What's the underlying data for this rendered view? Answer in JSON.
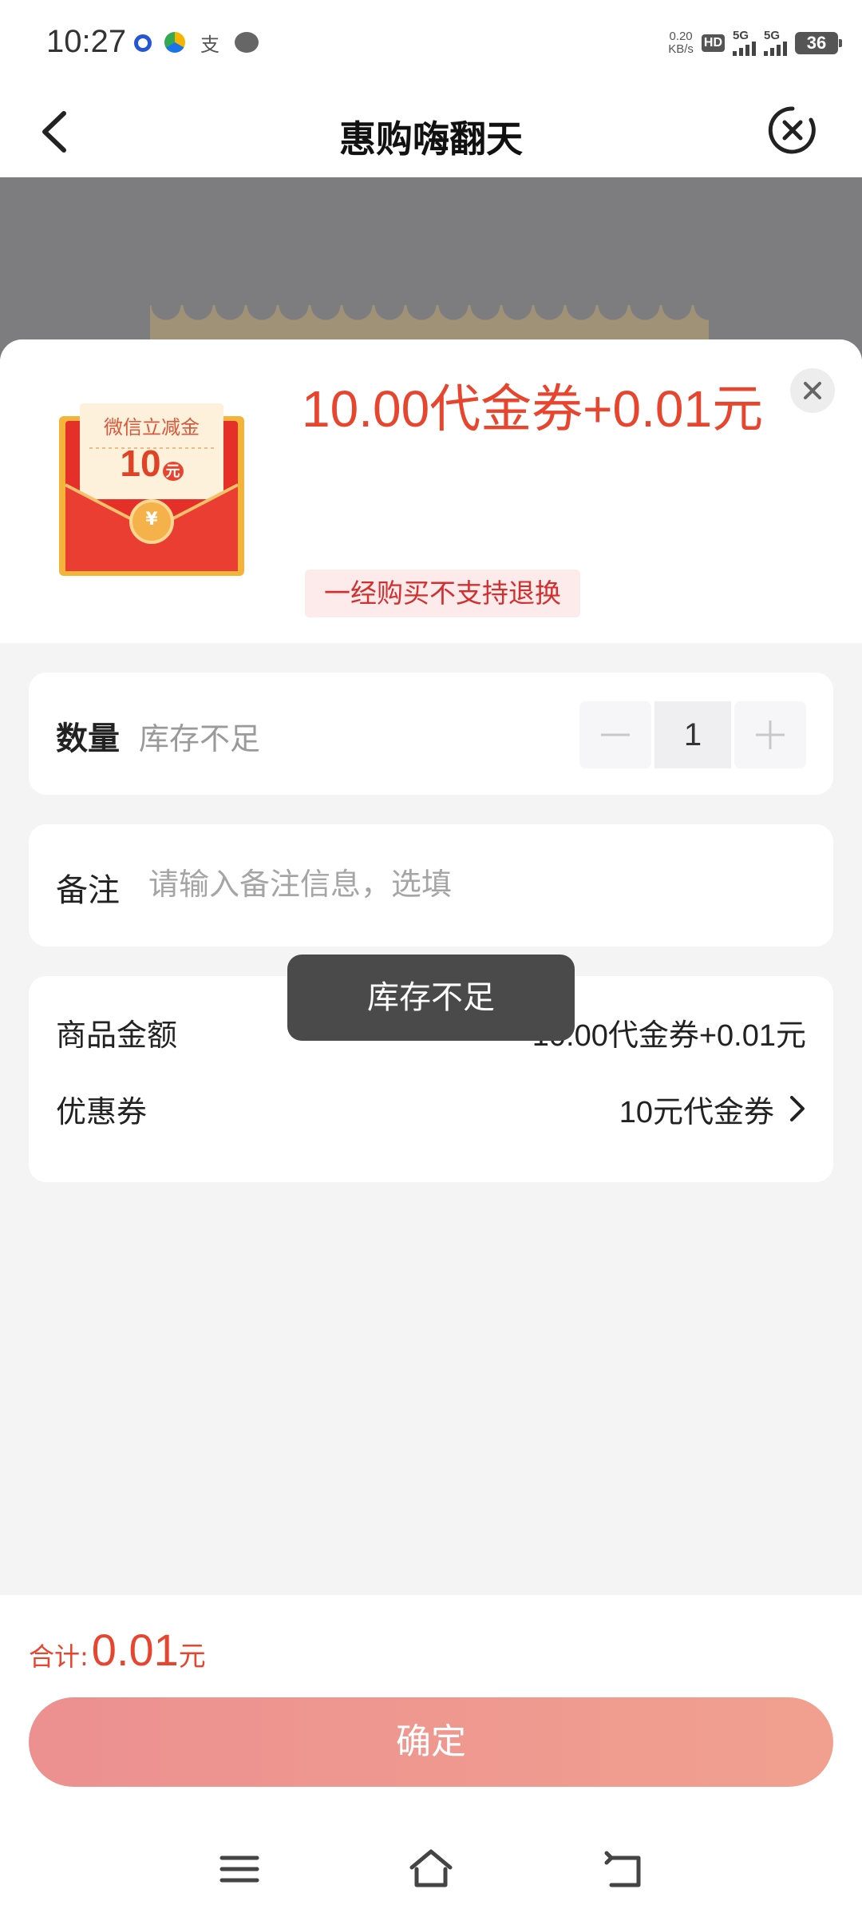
{
  "status_bar": {
    "time": "10:27",
    "net_speed_value": "0.20",
    "net_speed_unit": "KB/s",
    "hd_label": "HD",
    "sim1_label": "5G",
    "sim2_label": "5G",
    "battery": "36"
  },
  "nav": {
    "title": "惠购嗨翻天"
  },
  "product": {
    "image_caption": "微信立减金",
    "image_amount": "10",
    "image_amount_unit": "元",
    "price_text": "10.00代金券+0.01元",
    "refund_tag": "一经购买不支持退换"
  },
  "quantity": {
    "label": "数量",
    "stock_note": "库存不足",
    "minus_symbol": "—",
    "value": "1",
    "plus_symbol": "+"
  },
  "note": {
    "label": "备注",
    "placeholder": "请输入备注信息，选填"
  },
  "summary": {
    "goods_amount_label": "商品金额",
    "goods_amount_value": "10.00代金券+0.01元",
    "coupon_label": "优惠券",
    "coupon_value": "10元代金券"
  },
  "toast": {
    "text": "库存不足"
  },
  "footer": {
    "total_label": "合计:",
    "total_value": "0.01",
    "total_unit": "元",
    "confirm_label": "确定"
  },
  "colors": {
    "price_red": "#e8452f",
    "confirm_gradient_start": "#ec9090",
    "confirm_gradient_end": "#f1a08f"
  }
}
